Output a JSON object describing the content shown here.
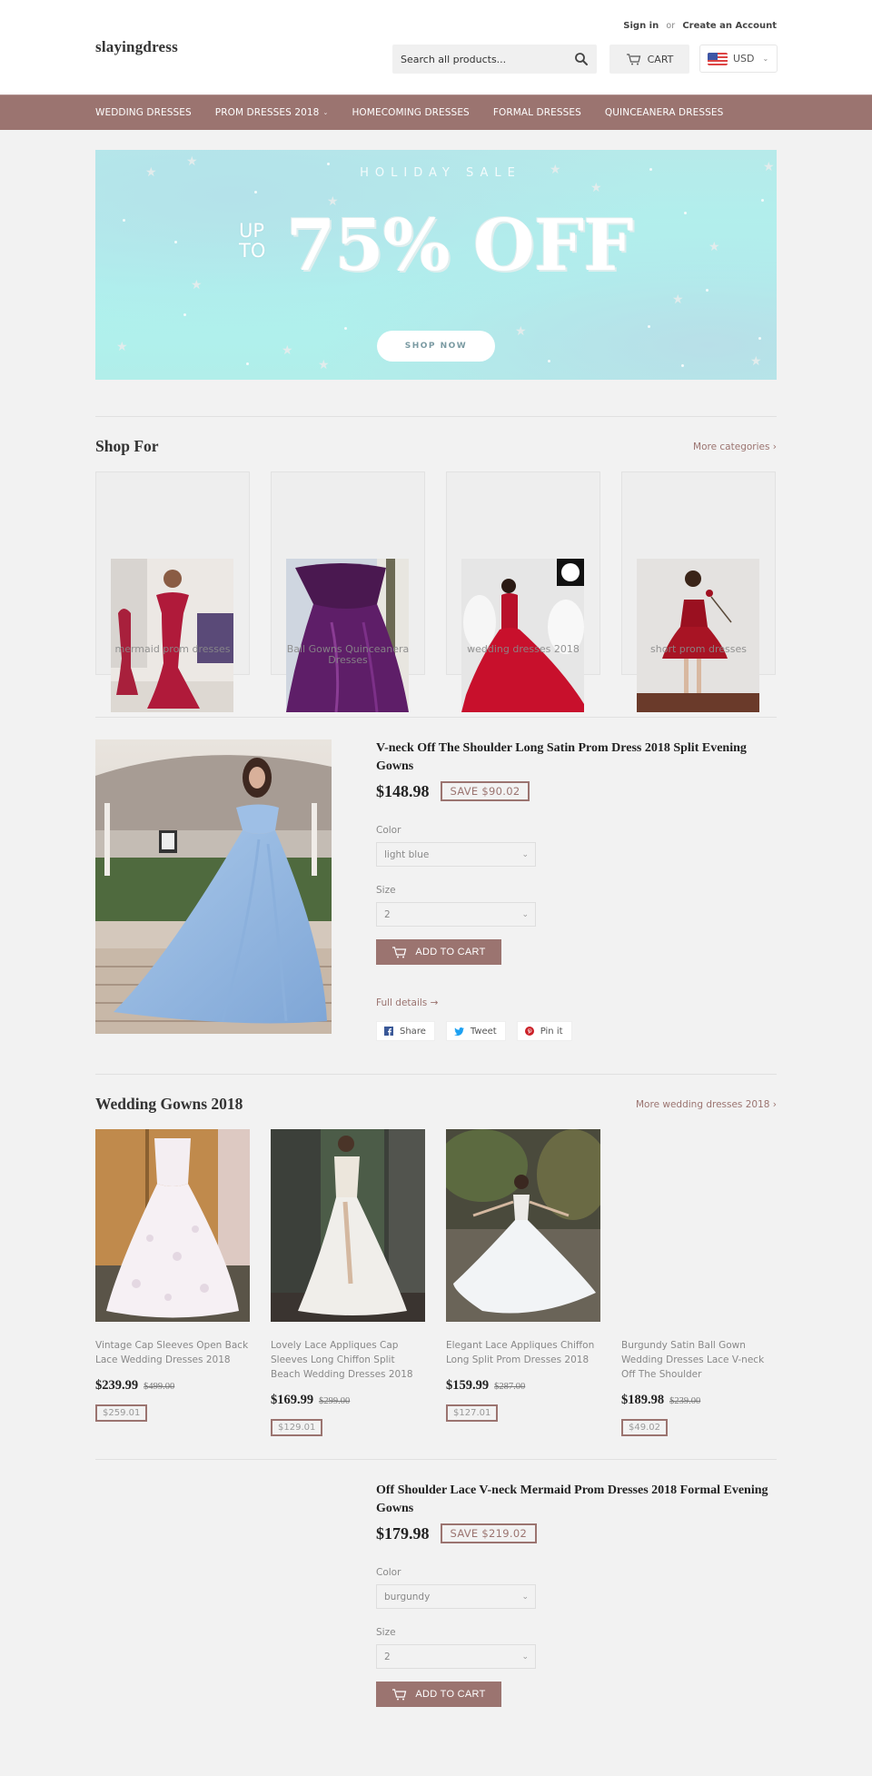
{
  "header": {
    "logo": "slayingdress",
    "sign_in": "Sign in",
    "or": "or",
    "create_account": "Create an Account",
    "search_placeholder": "Search all products...",
    "cart_label": "CART",
    "currency": "USD"
  },
  "nav": {
    "items": [
      {
        "label": "WEDDING DRESSES",
        "dropdown": false
      },
      {
        "label": "PROM DRESSES 2018",
        "dropdown": true
      },
      {
        "label": "HOMECOMING DRESSES",
        "dropdown": false
      },
      {
        "label": "FORMAL DRESSES",
        "dropdown": false
      },
      {
        "label": "QUINCEANERA DRESSES",
        "dropdown": false
      }
    ]
  },
  "hero": {
    "kicker": "HOLIDAY SALE",
    "up": "UP",
    "to": "TO",
    "headline": "75% OFF",
    "button": "SHOP NOW"
  },
  "shop_for": {
    "title": "Shop For",
    "more_link": "More categories ›",
    "collections": [
      {
        "label": "mermaid prom dresses",
        "image": "red-mermaid-dress"
      },
      {
        "label": "Ball Gowns Quinceanera Dresses",
        "image": "purple-ball-gown"
      },
      {
        "label": "wedding dresses 2018",
        "image": "red-tulle-ball-gown"
      },
      {
        "label": "short prom dresses",
        "image": "short-red-dress"
      }
    ]
  },
  "featured_1": {
    "title": "V-neck Off The Shoulder Long Satin Prom Dress 2018 Split Evening Gowns",
    "price": "$148.98",
    "save": "SAVE $90.02",
    "color_label": "Color",
    "color_value": "light blue",
    "size_label": "Size",
    "size_value": "2",
    "add_to_cart": "ADD TO CART",
    "full_details": "Full details →",
    "share": "Share",
    "tweet": "Tweet",
    "pin": "Pin it"
  },
  "wedding": {
    "title": "Wedding Gowns 2018",
    "more_link": "More wedding dresses 2018 ›",
    "products": [
      {
        "name": "Vintage Cap Sleeves Open Back Lace Wedding Dresses 2018",
        "price": "$239.99",
        "compare": "$499.00",
        "save": "$259.01"
      },
      {
        "name": "Lovely Lace Appliques Cap Sleeves Long Chiffon Split Beach Wedding Dresses 2018",
        "price": "$169.99",
        "compare": "$299.00",
        "save": "$129.01"
      },
      {
        "name": "Elegant Lace Appliques Chiffon Long Split Prom Dresses 2018",
        "price": "$159.99",
        "compare": "$287.00",
        "save": "$127.01"
      },
      {
        "name": "Burgundy Satin Ball Gown Wedding Dresses Lace V-neck Off The Shoulder",
        "price": "$189.98",
        "compare": "$239.00",
        "save": "$49.02"
      }
    ]
  },
  "featured_2": {
    "title": "Off Shoulder Lace V-neck Mermaid Prom Dresses 2018 Formal Evening Gowns",
    "price": "$179.98",
    "save": "SAVE $219.02",
    "color_label": "Color",
    "color_value": "burgundy",
    "size_label": "Size",
    "size_value": "2",
    "add_to_cart": "ADD TO CART"
  },
  "colors": {
    "accent": "#9b7470",
    "background": "#f2f2f2"
  }
}
